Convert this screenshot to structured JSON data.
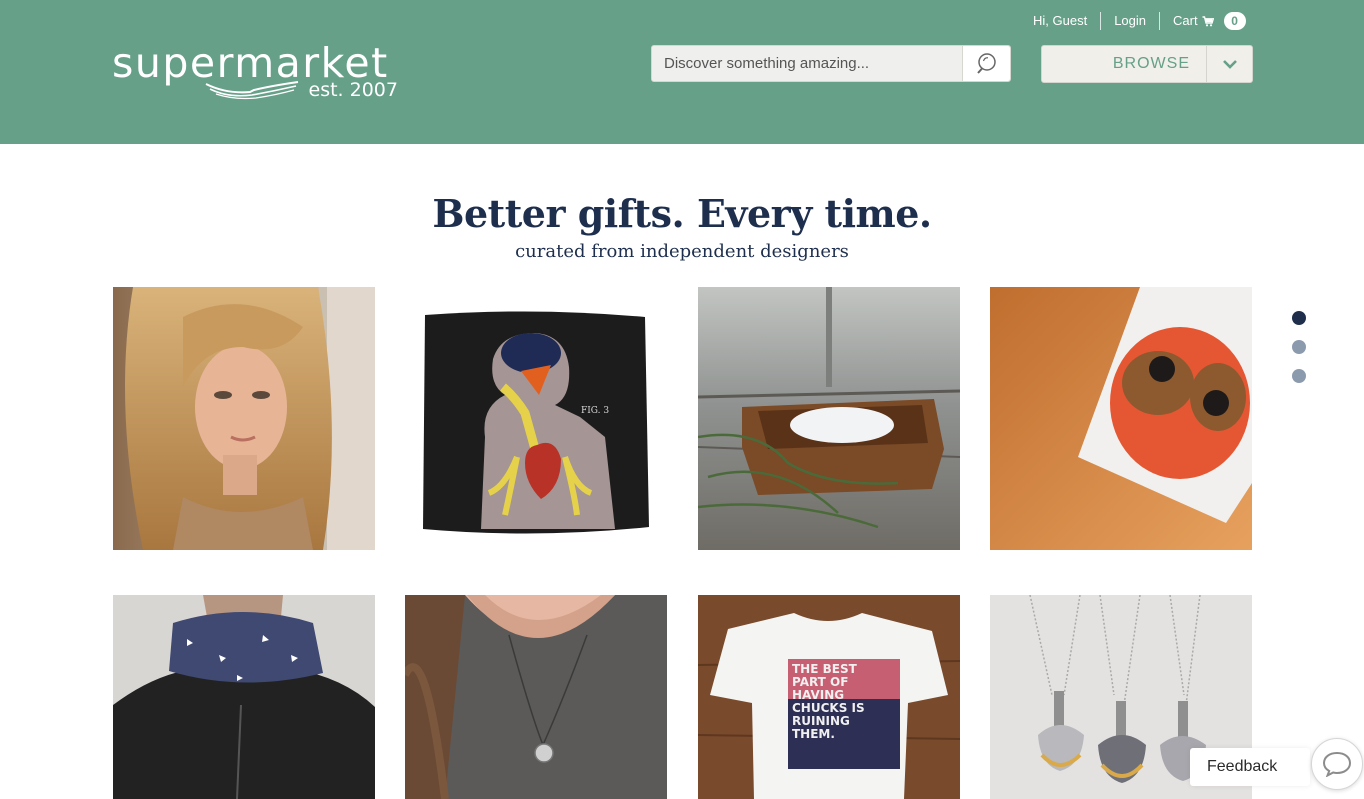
{
  "brand": {
    "name": "supermarket",
    "tagline": "est. 2007"
  },
  "user_nav": {
    "greeting": "Hi, Guest",
    "login": "Login",
    "cart_label": "Cart",
    "cart_count": "0"
  },
  "search": {
    "placeholder": "Discover something amazing...",
    "button_icon": "search-icon"
  },
  "browse": {
    "label": "BROWSE",
    "toggle_icon": "chevron-down-icon"
  },
  "hero": {
    "title": "Better gifts. Every time.",
    "subtitle": "curated from independent designers"
  },
  "products": [
    {
      "subject": "woman-portrait-photo"
    },
    {
      "subject": "anatomy-pillow-photo",
      "print": "FIG. 3"
    },
    {
      "subject": "salt-bowl-photo"
    },
    {
      "subject": "owl-card-photo"
    },
    {
      "subject": "scarf-photo"
    },
    {
      "subject": "necklace-photo"
    },
    {
      "subject": "tshirt-photo",
      "print": [
        "THE BEST",
        "PART OF",
        "HAVING",
        "CHUCKS IS",
        "RUINING",
        "THEM."
      ]
    },
    {
      "subject": "pendants-photo"
    }
  ],
  "carousel": {
    "page_count": 3,
    "active_page": 1
  },
  "feedback": {
    "label": "Feedback"
  },
  "colors": {
    "header_bg": "#66a089",
    "accent": "#66a089",
    "title_text": "#1e2f4e",
    "dot_active": "#1f2e4a",
    "dot_inactive": "#8c9aae"
  }
}
